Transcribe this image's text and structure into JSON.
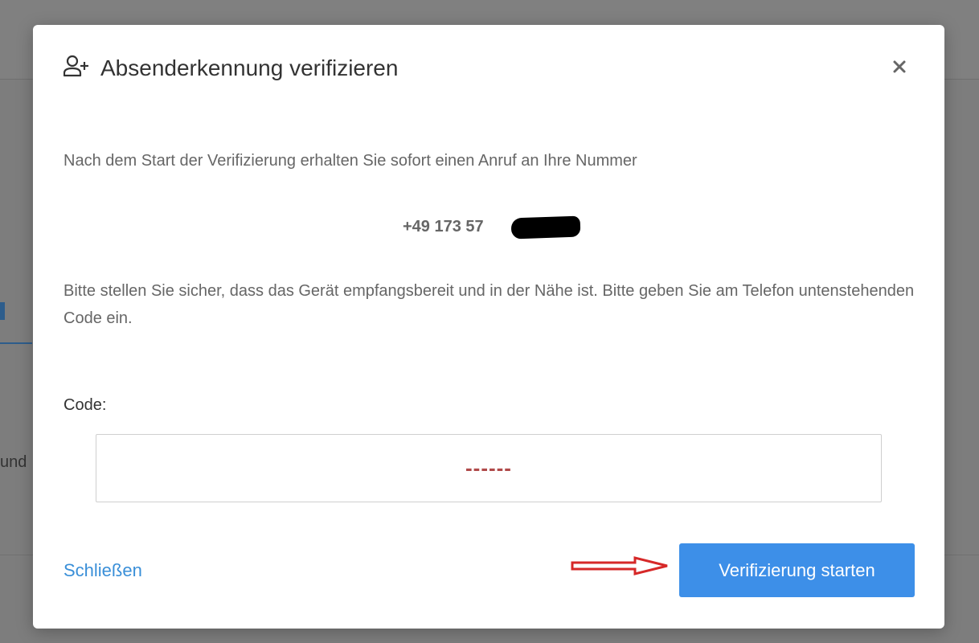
{
  "background": {
    "partial_text": "und"
  },
  "dialog": {
    "title": "Absenderkennung verifizieren",
    "title_icon": "add-user-icon",
    "close_icon": "close-icon",
    "intro": "Nach dem Start der Verifizierung erhalten Sie sofort einen Anruf an Ihre Nummer",
    "phone_number": "+49 173 57",
    "instructions": "Bitte stellen Sie sicher, dass das Gerät empfangsbereit und in der Nähe ist. Bitte geben Sie am Telefon untenstehenden Code ein.",
    "code_label": "Code:",
    "code_value": "------",
    "close_link": "Schließen",
    "start_button": "Verifizierung starten"
  },
  "colors": {
    "accent": "#3d8fe8",
    "link": "#3a8fd8",
    "code_placeholder": "#b04a4a",
    "annotation_arrow": "#d62828"
  }
}
